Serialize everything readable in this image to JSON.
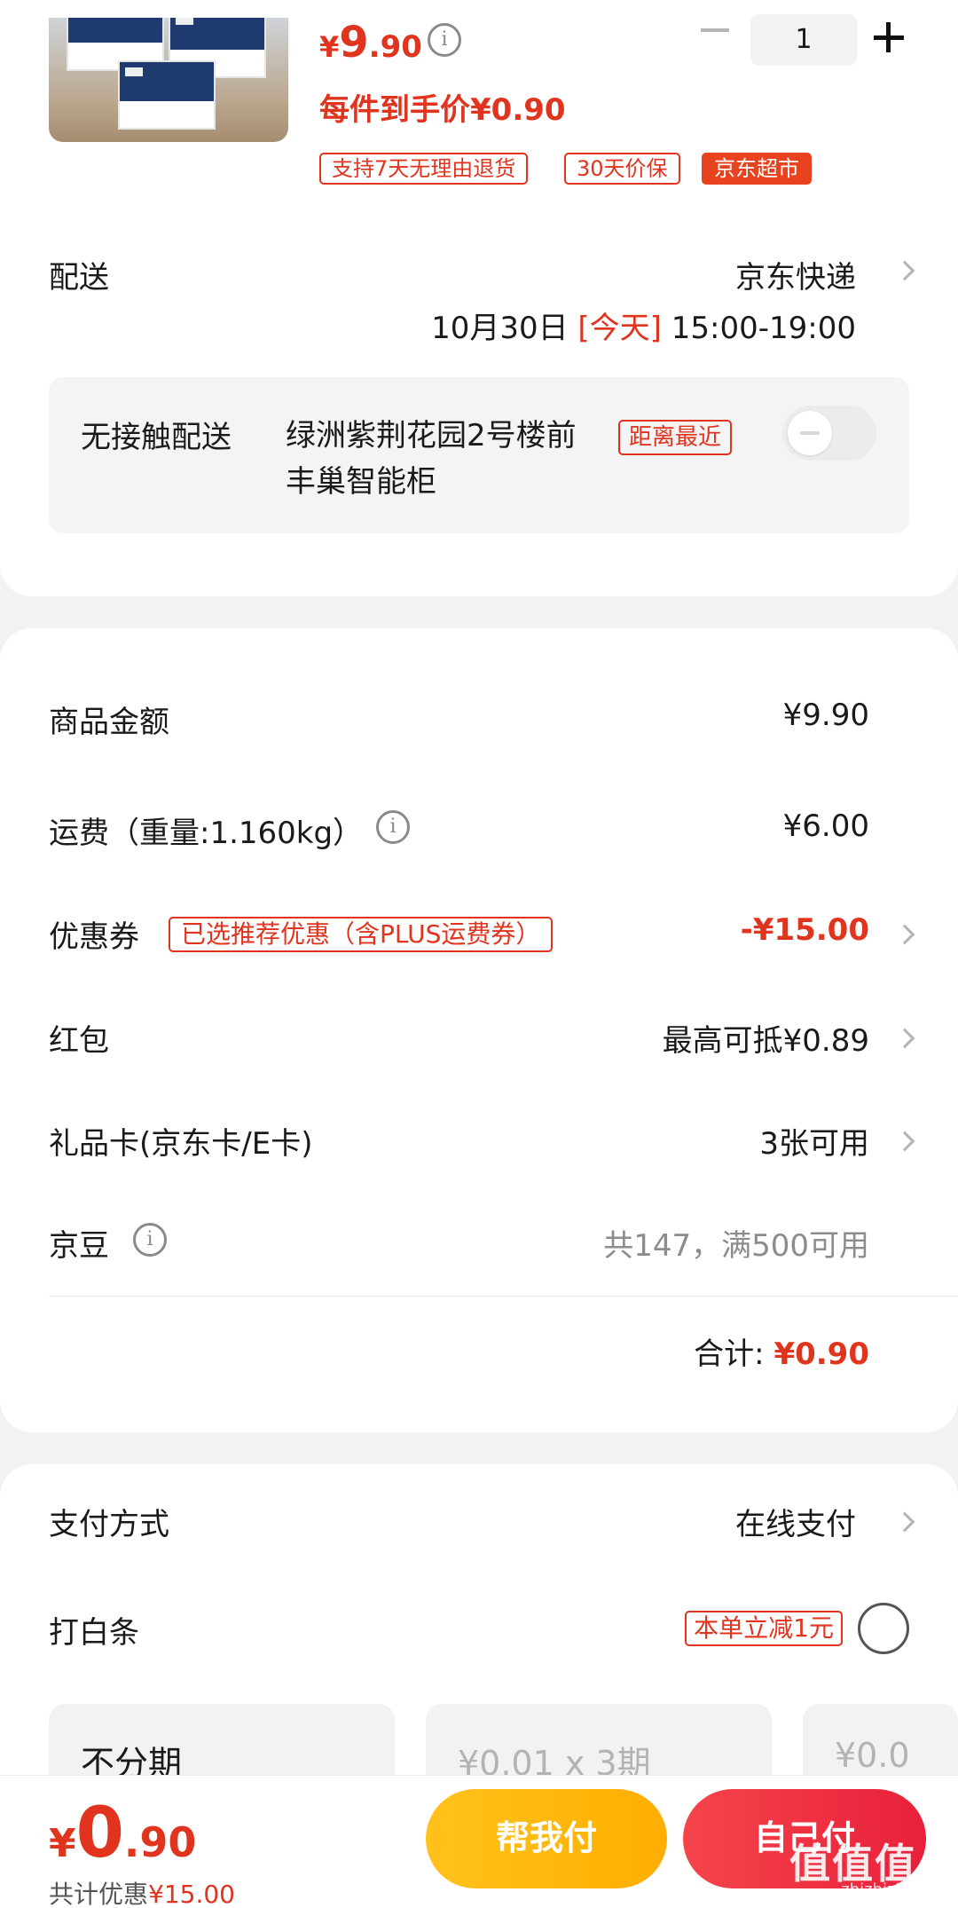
{
  "product": {
    "price_yen": "¥",
    "price_int": "9",
    "price_dec": ".90",
    "per_item_price": "每件到手价¥0.90",
    "quantity": "1",
    "tags": [
      "支持7天无理由退货",
      "30天价保",
      "京东超市"
    ]
  },
  "delivery": {
    "label": "配送",
    "carrier": "京东快递",
    "date": "10月30日",
    "today": "[今天]",
    "time": "15:00-19:00",
    "contactless_label": "无接触配送",
    "address": "绿洲紫荆花园2号楼前丰巢智能柜",
    "distance_tag": "距离最近"
  },
  "summary": {
    "goods_label": "商品金额",
    "goods_value": "¥9.90",
    "shipping_label": "运费（重量:1.160kg）",
    "shipping_value": "¥6.00",
    "coupon_label": "优惠券",
    "coupon_tag": "已选推荐优惠（含PLUS运费券）",
    "coupon_value": "-¥15.00",
    "redpacket_label": "红包",
    "redpacket_value": "最高可抵¥0.89",
    "giftcard_label": "礼品卡(京东卡/E卡)",
    "giftcard_value": "3张可用",
    "jingdou_label": "京豆",
    "jingdou_value": "共147，满500可用",
    "total_label": "合计:",
    "total_value": "¥0.90"
  },
  "payment": {
    "method_label": "支付方式",
    "method_value": "在线支付",
    "baitiao_label": "打白条",
    "baitiao_tag": "本单立减1元",
    "plans": [
      "不分期",
      "¥0.01 x 3期",
      "¥0.0"
    ]
  },
  "bottom": {
    "price_yen": "¥",
    "price_int": "0",
    "price_dec": ".90",
    "saved_label": "共计优惠",
    "saved_value": "¥15.00",
    "help_pay": "帮我付",
    "self_pay": "自己付",
    "watermark_logo": "值值值",
    "watermark_url": "zhizhizhi.com"
  },
  "colors": {
    "accent_red": "#e0341e",
    "help_button": "#ffb400",
    "self_button": "#ee2f40"
  },
  "icons": [
    "info-icon",
    "minus-icon",
    "plus-icon",
    "chevron-right-icon",
    "toggle-switch",
    "radio-button"
  ]
}
